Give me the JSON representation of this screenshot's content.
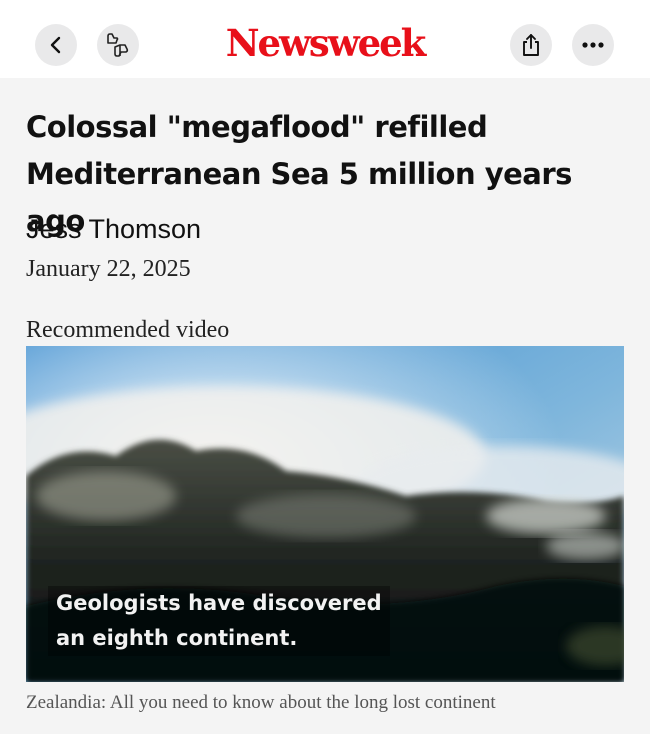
{
  "header": {
    "brand": "Newsweek",
    "brand_color": "#e8101a",
    "back_icon": "chevron-left-icon",
    "reactions_icon": "thumbs-reaction-icon",
    "share_icon": "share-icon",
    "more_icon": "ellipsis-icon"
  },
  "article": {
    "title": "Colossal \"megaflood\" refilled Mediterranean Sea 5 million years ago",
    "author": "Jess Thomson",
    "date": "January 22, 2025"
  },
  "video": {
    "section_label": "Recommended video",
    "subtitle_line1": "Geologists have discovered",
    "subtitle_line2": "an eighth continent.",
    "caption": "Zealandia: All you need to know about the long lost continent"
  }
}
